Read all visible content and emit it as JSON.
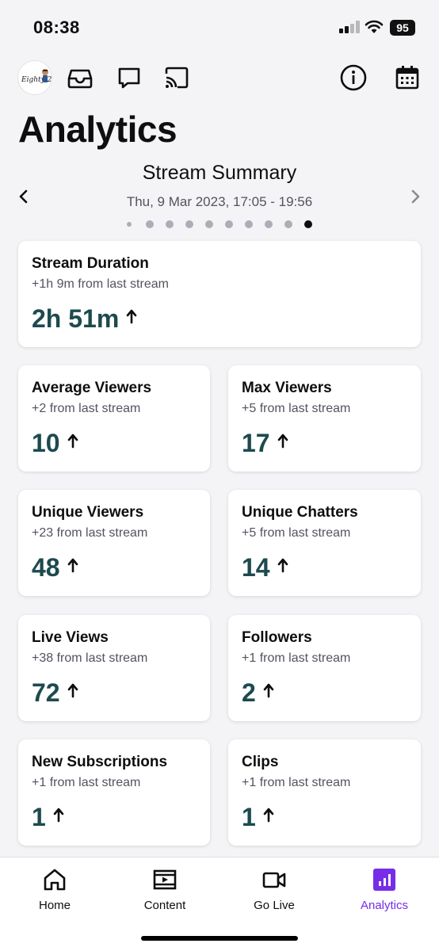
{
  "status_bar": {
    "time": "08:38",
    "battery": "95"
  },
  "header": {
    "avatar_label": "Eighty 2",
    "icons": [
      "inbox-icon",
      "chat-icon",
      "cast-icon",
      "info-icon",
      "calendar-icon"
    ]
  },
  "page": {
    "title": "Analytics"
  },
  "summary": {
    "title": "Stream Summary",
    "date": "Thu, 9 Mar 2023, 17:05 - 19:56",
    "dot_count": 10,
    "active_dot": 10
  },
  "cards": {
    "duration": {
      "title": "Stream Duration",
      "sub": "+1h 9m from last stream",
      "value": "2h 51m"
    },
    "avg_viewers": {
      "title": "Average Viewers",
      "sub": "+2 from last stream",
      "value": "10"
    },
    "max_viewers": {
      "title": "Max Viewers",
      "sub": "+5 from last stream",
      "value": "17"
    },
    "unique_viewers": {
      "title": "Unique Viewers",
      "sub": "+23 from last stream",
      "value": "48"
    },
    "unique_chatters": {
      "title": "Unique Chatters",
      "sub": "+5 from last stream",
      "value": "14"
    },
    "live_views": {
      "title": "Live Views",
      "sub": "+38 from last stream",
      "value": "72"
    },
    "followers": {
      "title": "Followers",
      "sub": "+1 from last stream",
      "value": "2"
    },
    "new_subs": {
      "title": "New Subscriptions",
      "sub": "+1 from last stream",
      "value": "1"
    },
    "clips": {
      "title": "Clips",
      "sub": "+1 from last stream",
      "value": "1"
    }
  },
  "bottom_nav": {
    "home": "Home",
    "content": "Content",
    "go_live": "Go Live",
    "analytics": "Analytics"
  },
  "colors": {
    "accent": "#772ce8",
    "value": "#1d4a4e",
    "background": "#f4f4f6"
  }
}
